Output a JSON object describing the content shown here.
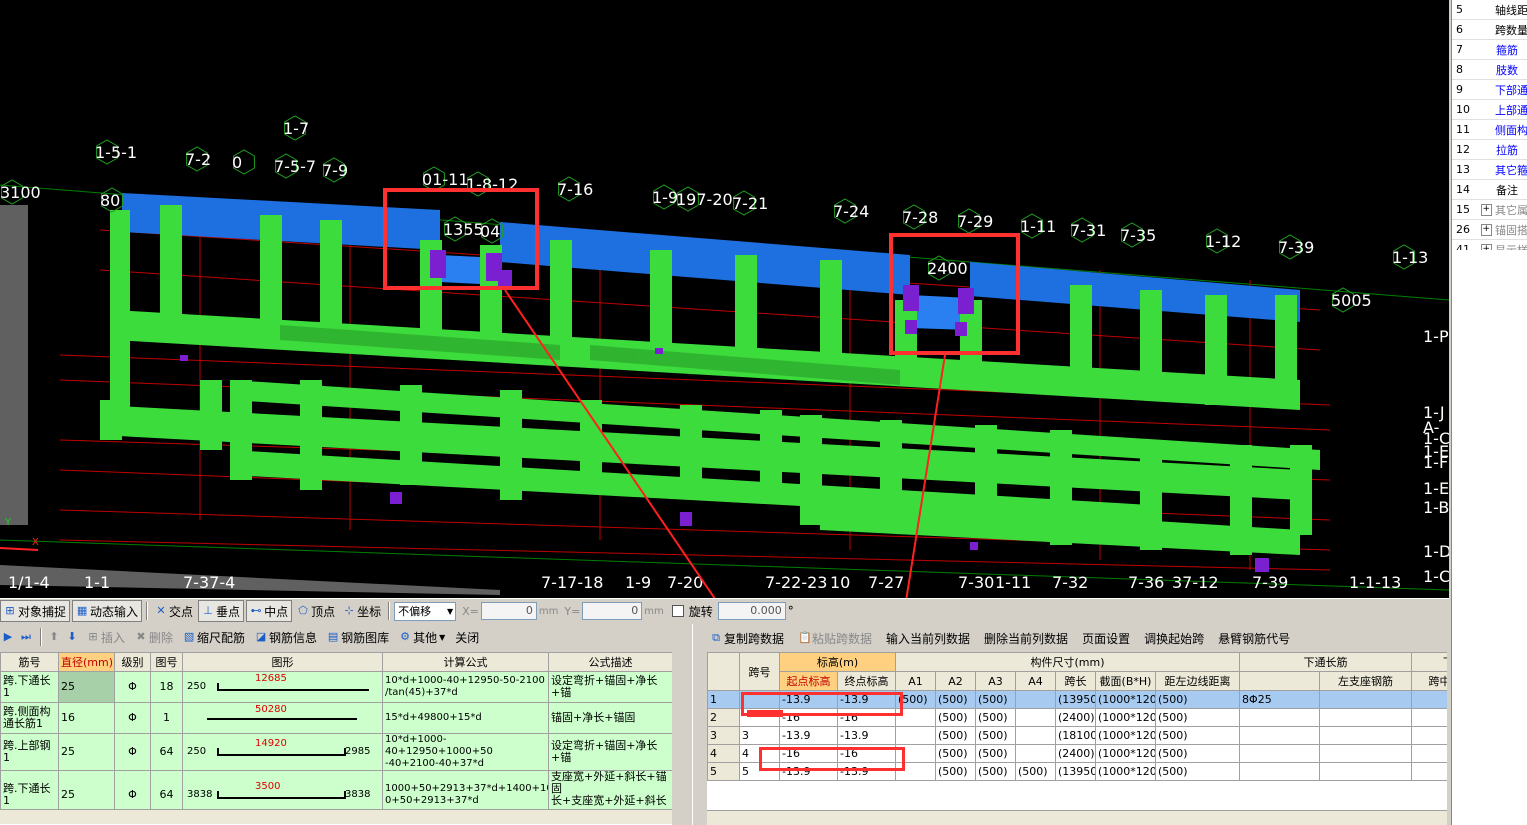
{
  "viewport": {
    "axis_labels_top": [
      "3100",
      "1-5-1",
      "1-7",
      "7-2",
      "0",
      "7-5-7",
      "7-9",
      "01-11",
      "1-8-12",
      "1355",
      "04",
      "7-16",
      "1-9",
      "197-20",
      "7-21",
      "7-24",
      "7-28",
      "7-29",
      "1-11",
      "7-31",
      "7-35",
      "1-12",
      "7-39",
      "1-13",
      "2400",
      "5005",
      "80"
    ],
    "axis_labels_bottom": [
      "1/1-4",
      "1-1",
      "7-37-4",
      "7-17-18",
      "1-9",
      "7-20",
      "7-22-23",
      "10",
      "7-27",
      "7-30",
      "1-11",
      "7-32",
      "7-36",
      "37-12",
      "7-39",
      "1-1-13"
    ],
    "axis_labels_right": [
      "1-P",
      "1-J",
      "A-",
      "1-C",
      "1-F",
      "1-E",
      "1-B",
      "1-D",
      "1-C",
      "1-E"
    ]
  },
  "property_panel": {
    "rows": [
      {
        "num": "5",
        "label": "轴线距",
        "style": "normal",
        "expander": false
      },
      {
        "num": "6",
        "label": "跨数量",
        "style": "normal",
        "expander": false
      },
      {
        "num": "7",
        "label": "箍筋",
        "style": "blue",
        "expander": false
      },
      {
        "num": "8",
        "label": "肢数",
        "style": "blue",
        "expander": false
      },
      {
        "num": "9",
        "label": "下部通",
        "style": "blue",
        "expander": false
      },
      {
        "num": "10",
        "label": "上部通",
        "style": "blue",
        "expander": false
      },
      {
        "num": "11",
        "label": "侧面构",
        "style": "blue",
        "expander": false
      },
      {
        "num": "12",
        "label": "拉筋",
        "style": "blue",
        "expander": false
      },
      {
        "num": "13",
        "label": "其它箍",
        "style": "blue",
        "expander": false
      },
      {
        "num": "14",
        "label": "备注",
        "style": "normal",
        "expander": false
      },
      {
        "num": "15",
        "label": "其它属",
        "style": "grey",
        "expander": true
      },
      {
        "num": "26",
        "label": "锚固搭",
        "style": "grey",
        "expander": true
      },
      {
        "num": "41",
        "label": "显示样",
        "style": "grey",
        "expander": true
      }
    ]
  },
  "snap_toolbar": {
    "object_snap": "对象捕捉",
    "dynamic_input": "动态输入",
    "intersection": "交点",
    "perpendicular": "垂点",
    "midpoint": "中点",
    "vertex": "顶点",
    "coordinate": "坐标",
    "offset_mode": "不偏移",
    "x_label": "X=",
    "x_value": "0",
    "y_label": "Y=",
    "y_value": "0",
    "unit": "mm",
    "rotate_label": "旋转",
    "rotate_value": "0.000",
    "degree": "°"
  },
  "rebar_toolbar": {
    "insert": "插入",
    "delete": "删除",
    "size_config": "缩尺配筋",
    "rebar_info": "钢筋信息",
    "rebar_library": "钢筋图库",
    "other": "其他",
    "close": "关闭"
  },
  "rebar_table": {
    "headers": [
      "筋号",
      "直径(mm)",
      "级别",
      "图号",
      "图形",
      "计算公式",
      "公式描述"
    ],
    "rows": [
      {
        "name": "跨.下通长\n1",
        "diameter": "25",
        "grade": "Φ",
        "fig": "18",
        "shape_left": "250",
        "shape_mid": "12685",
        "shape_right": "",
        "formula": "10*d+1000-40+12950-50-2100\n/tan(45)+37*d",
        "desc": "设定弯折+锚固+净长+锚"
      },
      {
        "name": "跨.侧面构\n通长筋1",
        "diameter": "16",
        "grade": "Φ",
        "fig": "1",
        "shape_left": "",
        "shape_mid": "50280",
        "shape_right": "",
        "formula": "15*d+49800+15*d",
        "desc": "锚固+净长+锚固"
      },
      {
        "name": "跨.上部钢\n1",
        "diameter": "25",
        "grade": "Φ",
        "fig": "64",
        "shape_left": "250",
        "shape_mid": "14920",
        "shape_right": "2985",
        "formula": "10*d+1000-40+12950+1000+50\n-40+2100-40+37*d",
        "desc": "设定弯折+锚固+净长+锚"
      },
      {
        "name": "跨.下通长\n1",
        "diameter": "25",
        "grade": "Φ",
        "fig": "64",
        "shape_left": "3838",
        "shape_mid": "3500",
        "shape_right": "3838",
        "formula": "1000+50+2913+37*d+1400+100\n0+50+2913+37*d",
        "desc": "支座宽+外延+斜长+锚固\n长+支座宽+外延+斜长+"
      }
    ]
  },
  "span_toolbar": {
    "copy": "复制跨数据",
    "paste": "粘贴跨数据",
    "input_col": "输入当前列数据",
    "delete_col": "删除当前列数据",
    "page_setup": "页面设置",
    "swap_start": "调换起始跨",
    "cantilever": "悬臂钢筋代号"
  },
  "span_table": {
    "header_group_elev": "标高(m)",
    "header_group_dims": "构件尺寸(mm)",
    "header_bottom_long": "下通长筋",
    "header_bottom": "下部",
    "headers": [
      "跨号",
      "起点标高",
      "终点标高",
      "A1",
      "A2",
      "A3",
      "A4",
      "跨长",
      "截面(B*H)",
      "距左边线距离",
      "左支座钢筋",
      "跨中"
    ],
    "rows": [
      {
        "idx": "1",
        "span": "",
        "start": "-13.9",
        "end": "-13.9",
        "a1": "(500)",
        "a2": "(500)",
        "a3": "(500)",
        "a4": "",
        "len": "(13950",
        "sec": "(1000*120",
        "dist": "(500)",
        "bottom": "8Φ25"
      },
      {
        "idx": "2",
        "span": "",
        "start": "-16",
        "end": "-16",
        "a1": "",
        "a2": "(500)",
        "a3": "(500)",
        "a4": "",
        "len": "(2400)",
        "sec": "(1000*120",
        "dist": "(500)",
        "bottom": ""
      },
      {
        "idx": "3",
        "span": "3",
        "start": "-13.9",
        "end": "-13.9",
        "a1": "",
        "a2": "(500)",
        "a3": "(500)",
        "a4": "",
        "len": "(18100",
        "sec": "(1000*120",
        "dist": "(500)",
        "bottom": ""
      },
      {
        "idx": "4",
        "span": "4",
        "start": "-16",
        "end": "-16",
        "a1": "",
        "a2": "(500)",
        "a3": "(500)",
        "a4": "",
        "len": "(2400)",
        "sec": "(1000*120",
        "dist": "(500)",
        "bottom": ""
      },
      {
        "idx": "5",
        "span": "5",
        "start": "-13.9",
        "end": "-13.9",
        "a1": "",
        "a2": "(500)",
        "a3": "(500)",
        "a4": "(500)",
        "len": "(13950",
        "sec": "(1000*120",
        "dist": "(500)",
        "bottom": ""
      }
    ]
  }
}
